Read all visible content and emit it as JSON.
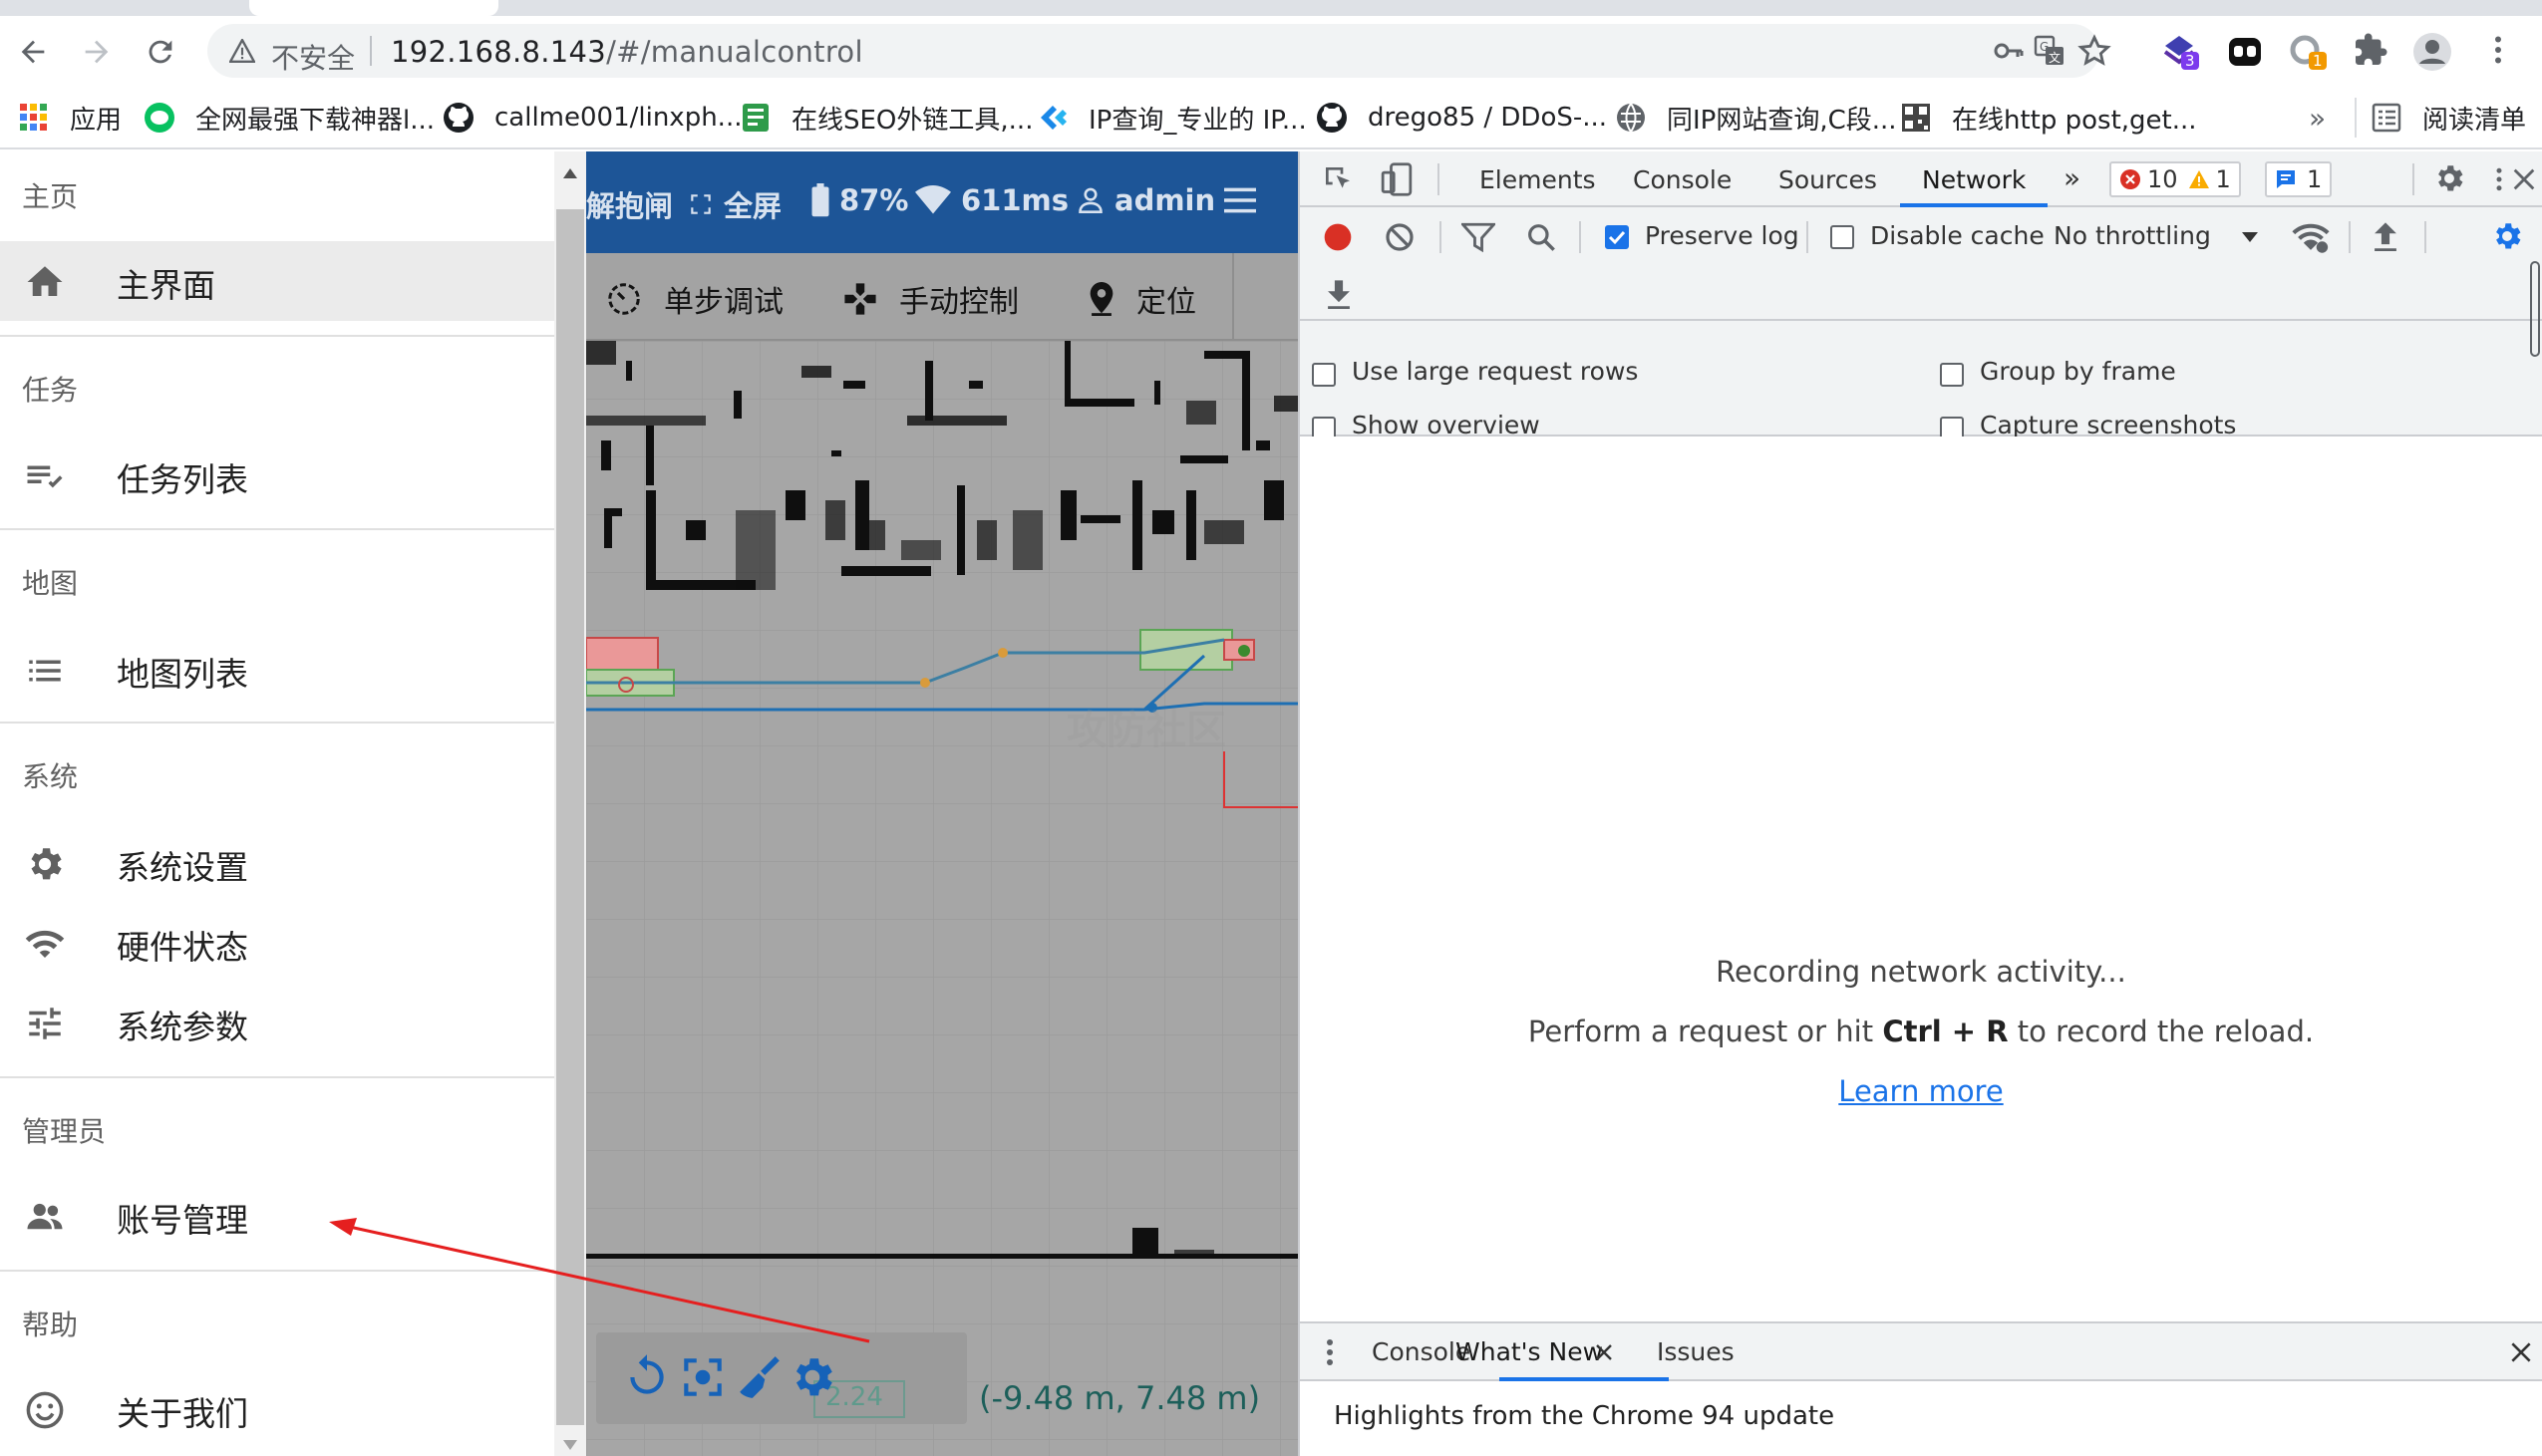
{
  "browser": {
    "security_label": "不安全",
    "url_host": "192.168.8.143",
    "url_path": "/#/manualcontrol",
    "extension_badges": {
      "ext1": "3",
      "ext2": "1"
    },
    "bookmarks": [
      {
        "icon": "apps-grid-icon",
        "label": "应用"
      },
      {
        "icon": "wechat-icon",
        "label": "全网最强下载神器l..."
      },
      {
        "icon": "github-icon",
        "label": "callme001/linxph..."
      },
      {
        "icon": "seo-tool-icon",
        "label": "在线SEO外链工具,..."
      },
      {
        "icon": "ip-query-icon",
        "label": "IP查询_专业的 IP..."
      },
      {
        "icon": "github-icon",
        "label": "drego85 / DDoS-..."
      },
      {
        "icon": "globe-icon",
        "label": "同IP网站查询,C段..."
      },
      {
        "icon": "qr-icon",
        "label": "在线http post,get..."
      }
    ],
    "bookmarks_overflow": "»",
    "reading_list": "阅读清单"
  },
  "drawer": {
    "sections": [
      {
        "title": "主页",
        "items": [
          {
            "icon": "home-icon",
            "label": "主界面",
            "active": true
          }
        ]
      },
      {
        "title": "任务",
        "items": [
          {
            "icon": "checklist-icon",
            "label": "任务列表"
          }
        ]
      },
      {
        "title": "地图",
        "items": [
          {
            "icon": "list-icon",
            "label": "地图列表"
          }
        ]
      },
      {
        "title": "系统",
        "items": [
          {
            "icon": "gear-icon",
            "label": "系统设置"
          },
          {
            "icon": "wifi-settings-icon",
            "label": "硬件状态"
          },
          {
            "icon": "tune-icon",
            "label": "系统参数"
          }
        ]
      },
      {
        "title": "管理员",
        "items": [
          {
            "icon": "people-icon",
            "label": "账号管理"
          }
        ]
      },
      {
        "title": "帮助",
        "items": [
          {
            "icon": "smile-icon",
            "label": "关于我们"
          }
        ]
      }
    ]
  },
  "app": {
    "appbar": {
      "release_brake": "解抱闸",
      "fullscreen": "全屏",
      "battery": "87%",
      "latency": "611ms",
      "user": "admin"
    },
    "modes": {
      "step_debug": "单步调试",
      "manual_control": "手动控制",
      "locate": "定位"
    },
    "coords": "(-9.48 m, 7.48 m)",
    "speed_value": "2.24",
    "watermark": "攻防社区"
  },
  "devtools": {
    "tabs": [
      "Elements",
      "Console",
      "Sources",
      "Network"
    ],
    "active_tab": "Network",
    "more": "»",
    "errors": "10",
    "warnings": "1",
    "messages": "1",
    "preserve_log": "Preserve log",
    "disable_cache": "Disable cache",
    "throttling": "No throttling",
    "use_large_rows": "Use large request rows",
    "show_overview": "Show overview",
    "group_by_frame": "Group by frame",
    "capture_screenshots": "Capture screenshots",
    "recording": "Recording network activity...",
    "perform_prefix": "Perform a request or hit ",
    "shortcut": "Ctrl + R",
    "perform_suffix": " to record the reload.",
    "learn_more": "Learn more",
    "drawer_tabs": [
      "Console",
      "What's New",
      "Issues"
    ],
    "highlights": "Highlights from the Chrome 94 update"
  }
}
